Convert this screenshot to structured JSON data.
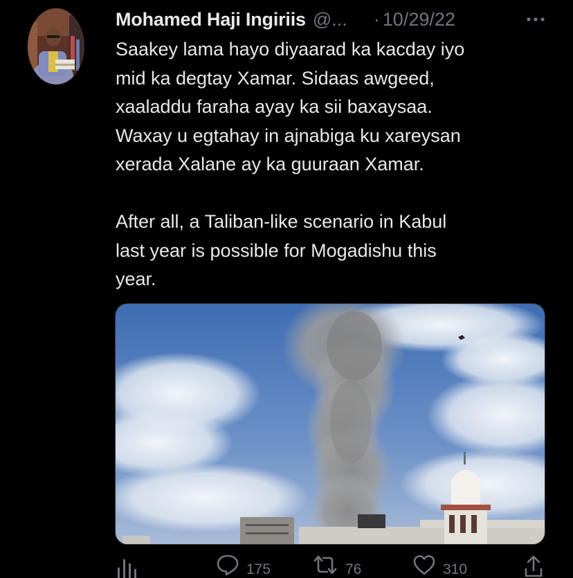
{
  "tweet": {
    "author": {
      "display_name": "Mohamed Haji Ingiriis",
      "handle": "@..."
    },
    "separator": "·",
    "date": "10/29/22",
    "text": [
      "Saakey lama hayo diyaarad ka kacday iyo\nmid ka degtay Xamar. Sidaas awgeed,\nxaaladdu faraha ayay ka sii baxaysaa.\nWaxay u egtahay in ajnabiga ku xareysan\nxerada Xalane ay ka guuraan Xamar.",
      "After all, a Taliban-like scenario in Kabul\nlast year is possible for Mogadishu this\nyear."
    ],
    "actions": {
      "analytics_icon": "bar-chart-icon",
      "replies": {
        "icon": "speech-bubble-icon",
        "count": "175"
      },
      "retweets": {
        "icon": "retweet-arrows-icon",
        "count": "76"
      },
      "likes": {
        "icon": "heart-icon",
        "count": "310"
      },
      "share_icon": "share-upload-icon"
    }
  },
  "colors": {
    "background": "#000000",
    "primary_text": "#e7e9ea",
    "secondary_text": "#71767b"
  }
}
